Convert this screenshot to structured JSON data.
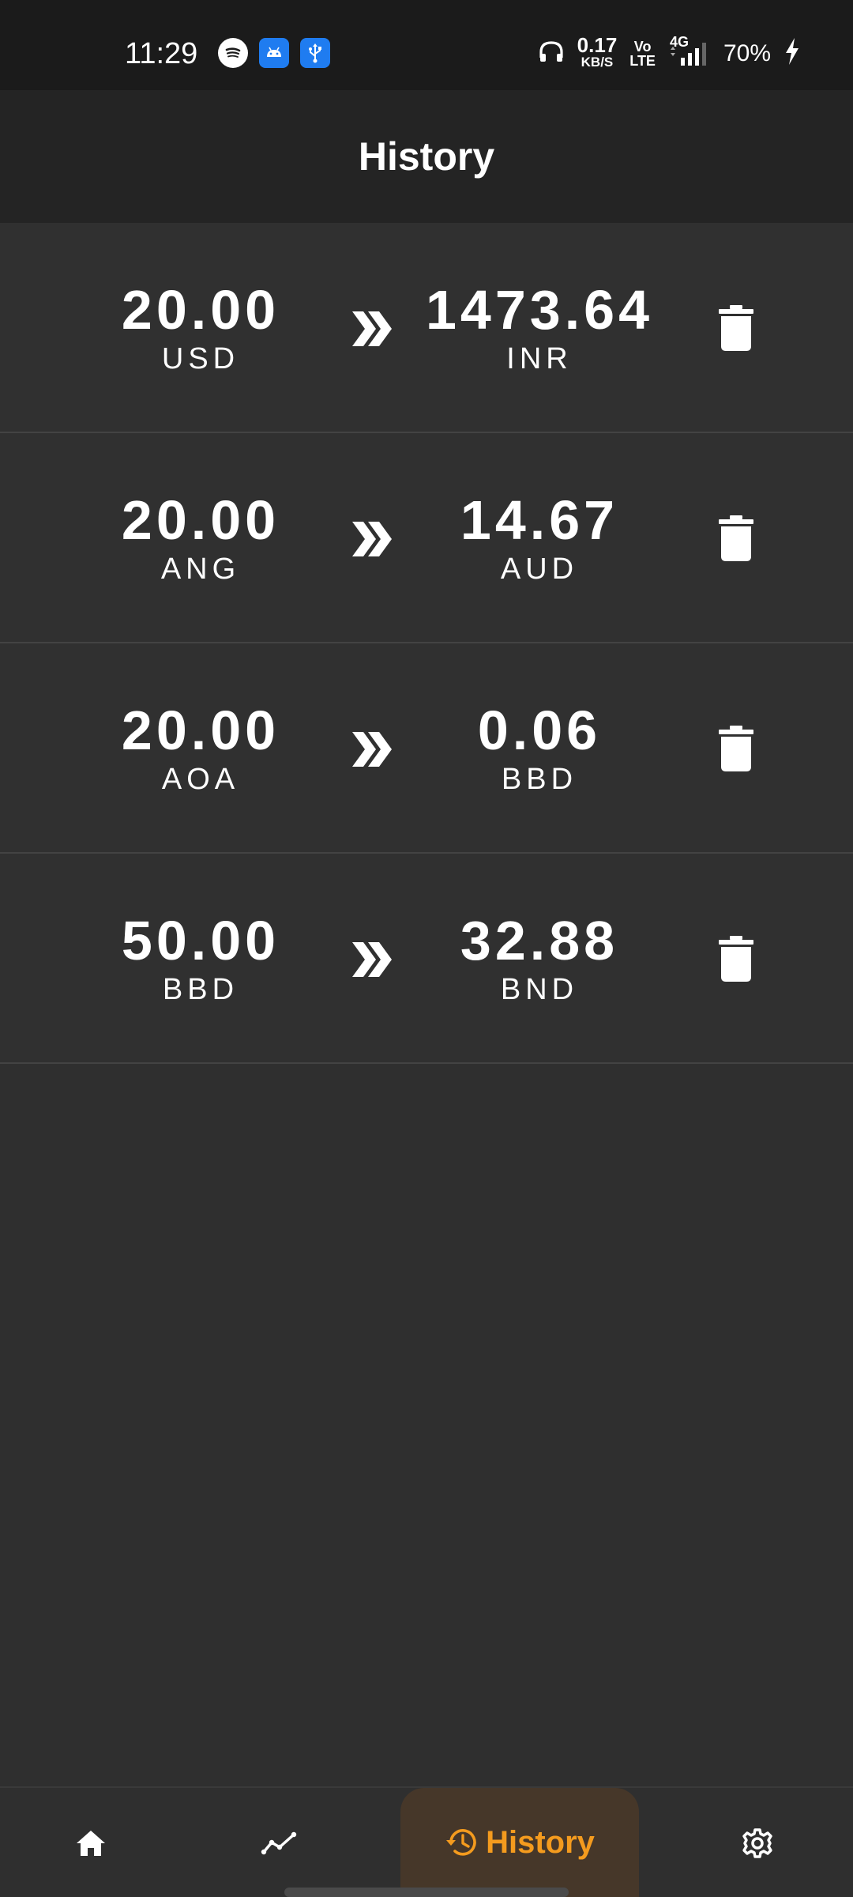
{
  "status_bar": {
    "time": "11:29",
    "net_speed_value": "0.17",
    "net_speed_unit": "KB/S",
    "volte_top": "Vo",
    "volte_bottom": "LTE",
    "network": "4G",
    "battery": "70%",
    "icons": [
      "spotify-icon",
      "android-icon",
      "usb-icon",
      "headphones-icon",
      "signal-icon",
      "charging-icon"
    ]
  },
  "app_bar": {
    "title": "History"
  },
  "history": {
    "items": [
      {
        "from_amount": "20.00",
        "from_code": "USD",
        "to_amount": "1473.64",
        "to_code": "INR"
      },
      {
        "from_amount": "20.00",
        "from_code": "ANG",
        "to_amount": "14.67",
        "to_code": "AUD"
      },
      {
        "from_amount": "20.00",
        "from_code": "AOA",
        "to_amount": "0.06",
        "to_code": "BBD"
      },
      {
        "from_amount": "50.00",
        "from_code": "BBD",
        "to_amount": "32.88",
        "to_code": "BND"
      }
    ]
  },
  "bottom_nav": {
    "history_label": "History",
    "active_color": "#f49b1e",
    "active_bg": "#463729"
  }
}
